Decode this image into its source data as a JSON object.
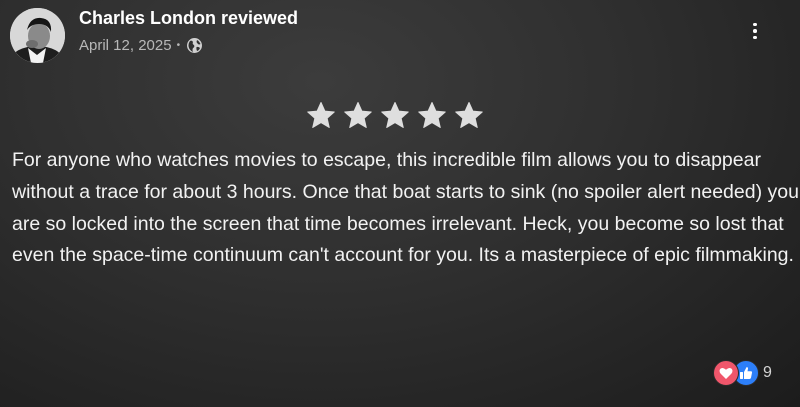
{
  "review": {
    "reviewer_name": "Charles London reviewed",
    "date": "April 12, 2025",
    "separator": "•",
    "audience_icon": "globe-icon",
    "options_icon": "more-vertical-icon",
    "rating": 5,
    "rating_max": 5,
    "text": "For anyone who watches movies to escape, this incredible film allows you to disappear without a trace for about 3 hours. Once that boat starts to sink (no spoiler alert needed) you are so locked into the screen that time becomes irrelevant. Heck, you become so lost that even the space-time continuum can't account for you. Its a masterpiece of epic filmmaking.",
    "reactions": {
      "icons": [
        "heart-icon",
        "like-icon"
      ],
      "count": "9"
    }
  },
  "colors": {
    "background": "#2f2f2f",
    "star": "#dedede",
    "heart": "#f0566b",
    "like": "#2d7ff9",
    "meta_text": "#b8b8b8"
  }
}
